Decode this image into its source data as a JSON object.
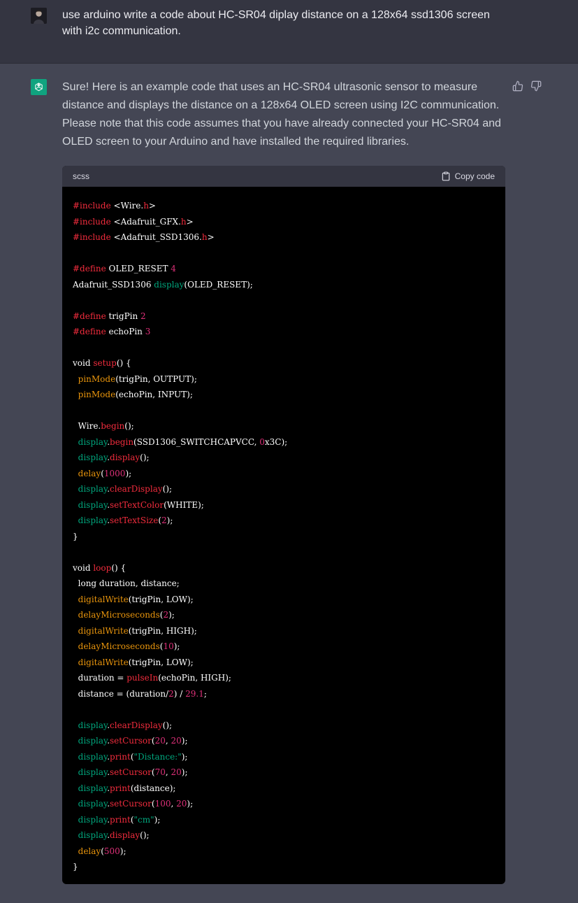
{
  "user_message": {
    "text": "use arduino write a code about HC-SR04 diplay distance on a 128x64 ssd1306 screen with i2c communication."
  },
  "assistant_message": {
    "text": "Sure! Here is an example code that uses an HC-SR04 ultrasonic sensor to measure distance and displays the distance on a 128x64 OLED screen using I2C communication. Please note that this code assumes that you have already connected your HC-SR04 and OLED screen to your Arduino and have installed the required libraries.",
    "code_block": {
      "language": "scss",
      "copy_label": "Copy code"
    }
  },
  "icons": {
    "avatar": "user-avatar",
    "gpt": "openai-logo-icon",
    "like": "thumbs-up-icon",
    "dislike": "thumbs-down-icon",
    "copy": "clipboard-icon"
  },
  "colors": {
    "page_bg": "#444654",
    "user_row_bg": "#343541",
    "code_bg": "#000000",
    "code_header_bg": "#343541",
    "gpt_accent": "#10a37f"
  }
}
